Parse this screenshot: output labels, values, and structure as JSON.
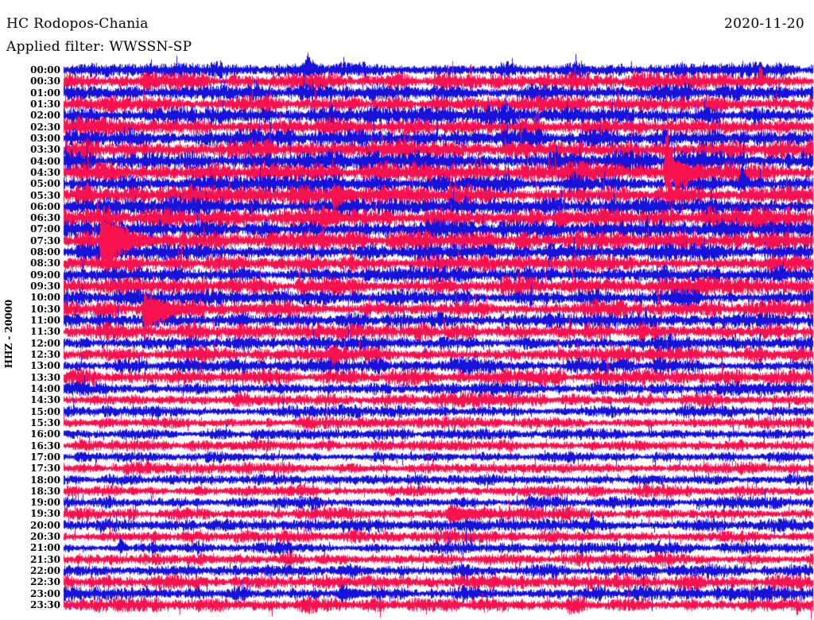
{
  "header": {
    "station_title": "HC Rodopos-Chania",
    "filter_label": "Applied filter: WWSSN-SP",
    "date": "2020-11-20"
  },
  "y_axis_label": "HHZ - 20000",
  "colors": {
    "background": "#ffffff",
    "text": "#000000",
    "blue": "#1612da",
    "red": "#f91250"
  },
  "chart_data": {
    "type": "line",
    "subtype": "helicorder-seismogram",
    "title": "HC Rodopos-Chania",
    "subtitle": "Applied filter: WWSSN-SP",
    "date": "2020-11-20",
    "ylabel": "HHZ - 20000",
    "xlabel": "",
    "minutes_per_row": 30,
    "rows_count": 48,
    "trace_color_cycle": [
      "blue",
      "red"
    ],
    "legend": "none",
    "grid": false,
    "rows": [
      {
        "time": "00:00",
        "color": "blue",
        "amplitude": 10,
        "events": [
          {
            "pos": 0.325,
            "up": 28,
            "down": 10,
            "decay": 10
          }
        ]
      },
      {
        "time": "00:30",
        "color": "red",
        "amplitude": 10.5,
        "events": [
          {
            "pos": 0.93,
            "up": 24,
            "down": 8,
            "decay": 6
          }
        ]
      },
      {
        "time": "01:00",
        "color": "blue",
        "amplitude": 10
      },
      {
        "time": "01:30",
        "color": "red",
        "amplitude": 10.5
      },
      {
        "time": "02:00",
        "color": "blue",
        "amplitude": 11
      },
      {
        "time": "02:30",
        "color": "red",
        "amplitude": 12
      },
      {
        "time": "03:00",
        "color": "blue",
        "amplitude": 12
      },
      {
        "time": "03:30",
        "color": "red",
        "amplitude": 12.5
      },
      {
        "time": "04:00",
        "color": "blue",
        "amplitude": 12.5
      },
      {
        "time": "04:30",
        "color": "red",
        "amplitude": 12.5,
        "events": [
          {
            "pos": 0.806,
            "up": 92,
            "down": 38,
            "decay": 5
          },
          {
            "pos": 0.816,
            "up": 18,
            "down": 30,
            "decay": 28
          }
        ]
      },
      {
        "time": "05:00",
        "color": "blue",
        "amplitude": 12,
        "events": [
          {
            "pos": 0.905,
            "up": 36,
            "down": 12,
            "decay": 6
          }
        ]
      },
      {
        "time": "05:30",
        "color": "red",
        "amplitude": 13,
        "events": [
          {
            "pos": 0.36,
            "up": 20,
            "down": 20,
            "decay": 25
          }
        ]
      },
      {
        "time": "06:00",
        "color": "blue",
        "amplitude": 12
      },
      {
        "time": "06:30",
        "color": "red",
        "amplitude": 12.5,
        "events": [
          {
            "pos": 0.345,
            "up": 18,
            "down": 18,
            "decay": 20
          },
          {
            "pos": 0.66,
            "up": 16,
            "down": 16,
            "decay": 18
          }
        ]
      },
      {
        "time": "07:00",
        "color": "blue",
        "amplitude": 11.5
      },
      {
        "time": "07:30",
        "color": "red",
        "amplitude": 12,
        "events": [
          {
            "pos": 0.051,
            "up": 42,
            "down": 40,
            "decay": 35
          }
        ]
      },
      {
        "time": "08:00",
        "color": "blue",
        "amplitude": 11
      },
      {
        "time": "08:30",
        "color": "red",
        "amplitude": 11
      },
      {
        "time": "09:00",
        "color": "blue",
        "amplitude": 10.5
      },
      {
        "time": "09:30",
        "color": "red",
        "amplitude": 11
      },
      {
        "time": "10:00",
        "color": "blue",
        "amplitude": 10
      },
      {
        "time": "10:30",
        "color": "red",
        "amplitude": 11,
        "events": [
          {
            "pos": 0.108,
            "up": 24,
            "down": 42,
            "decay": 28
          }
        ]
      },
      {
        "time": "11:00",
        "color": "blue",
        "amplitude": 10
      },
      {
        "time": "11:30",
        "color": "red",
        "amplitude": 10
      },
      {
        "time": "12:00",
        "color": "blue",
        "amplitude": 9.5
      },
      {
        "time": "12:30",
        "color": "red",
        "amplitude": 10,
        "events": [
          {
            "pos": 0.36,
            "up": 16,
            "down": 20,
            "decay": 10
          }
        ]
      },
      {
        "time": "13:00",
        "color": "blue",
        "amplitude": 9.5
      },
      {
        "time": "13:30",
        "color": "red",
        "amplitude": 10
      },
      {
        "time": "14:00",
        "color": "blue",
        "amplitude": 8.5
      },
      {
        "time": "14:30",
        "color": "red",
        "amplitude": 8.5
      },
      {
        "time": "15:00",
        "color": "blue",
        "amplitude": 7.5
      },
      {
        "time": "15:30",
        "color": "red",
        "amplitude": 7.5
      },
      {
        "time": "16:00",
        "color": "blue",
        "amplitude": 7
      },
      {
        "time": "16:30",
        "color": "red",
        "amplitude": 7.5
      },
      {
        "time": "17:00",
        "color": "blue",
        "amplitude": 7
      },
      {
        "time": "17:30",
        "color": "red",
        "amplitude": 7.5
      },
      {
        "time": "18:00",
        "color": "blue",
        "amplitude": 7
      },
      {
        "time": "18:30",
        "color": "red",
        "amplitude": 7.5
      },
      {
        "time": "19:00",
        "color": "blue",
        "amplitude": 7.5
      },
      {
        "time": "19:30",
        "color": "red",
        "amplitude": 8,
        "events": [
          {
            "pos": 0.515,
            "up": 13,
            "down": 13,
            "decay": 45
          }
        ]
      },
      {
        "time": "20:00",
        "color": "blue",
        "amplitude": 7.5,
        "events": [
          {
            "pos": 0.705,
            "up": 18,
            "down": 8,
            "decay": 8
          }
        ]
      },
      {
        "time": "20:30",
        "color": "red",
        "amplitude": 8
      },
      {
        "time": "21:00",
        "color": "blue",
        "amplitude": 7.5,
        "events": [
          {
            "pos": 0.075,
            "up": 16,
            "down": 8,
            "decay": 8
          }
        ]
      },
      {
        "time": "21:30",
        "color": "red",
        "amplitude": 8
      },
      {
        "time": "22:00",
        "color": "blue",
        "amplitude": 8.5
      },
      {
        "time": "22:30",
        "color": "red",
        "amplitude": 9
      },
      {
        "time": "23:00",
        "color": "blue",
        "amplitude": 9,
        "events": [
          {
            "pos": 0.37,
            "up": 12,
            "down": 12,
            "decay": 30
          }
        ]
      },
      {
        "time": "23:30",
        "color": "red",
        "amplitude": 9.5,
        "events": [
          {
            "pos": 0.98,
            "up": 6,
            "down": 16,
            "decay": 4
          }
        ]
      }
    ]
  }
}
